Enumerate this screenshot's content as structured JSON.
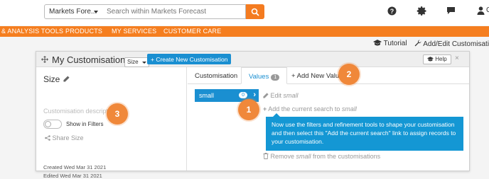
{
  "header": {
    "scope_select": "Markets Fore...",
    "search_placeholder": "Search within Markets Forecast",
    "user_initial": "C"
  },
  "nav": {
    "items": [
      "& ANALYSIS TOOLS",
      "PRODUCTS",
      "MY SERVICES",
      "CUSTOMER CARE"
    ]
  },
  "utility": {
    "tutorial": "Tutorial",
    "add_edit": "Add/Edit Customisations"
  },
  "panel": {
    "title": "My Customisations",
    "size_select": "Size",
    "create_button": "+ Create New Customisation",
    "help_button": "Help",
    "close": "×"
  },
  "left": {
    "name": "Size",
    "description_placeholder": "Customisation description.",
    "show_in_filters": "Show in Filters",
    "share": "Share Size",
    "created": "Created Wed Mar 31 2021",
    "edited": "Edited Wed Mar 31 2021"
  },
  "tabs": {
    "customisation": "Customisation",
    "values": "Values",
    "values_count": "1",
    "add_new": "+ Add New Value"
  },
  "value_item": {
    "label": "small",
    "count": "0"
  },
  "actions": {
    "edit_prefix": "Edit ",
    "edit_value": "small",
    "add_search_prefix": "Add the current search to ",
    "add_search_value": "small",
    "remove_prefix": "Remove ",
    "remove_value": "small",
    "remove_suffix": " from the customisations"
  },
  "tooltip": "Now use the filters and refinement tools to shape your customisation and then select this \"Add the current search\" link to assign records to your customisation.",
  "markers": [
    "1",
    "2",
    "3"
  ],
  "colors": {
    "brand_orange": "#f57e1f",
    "accent_blue": "#1a8fd1",
    "marker_orange": "#f0883a"
  }
}
